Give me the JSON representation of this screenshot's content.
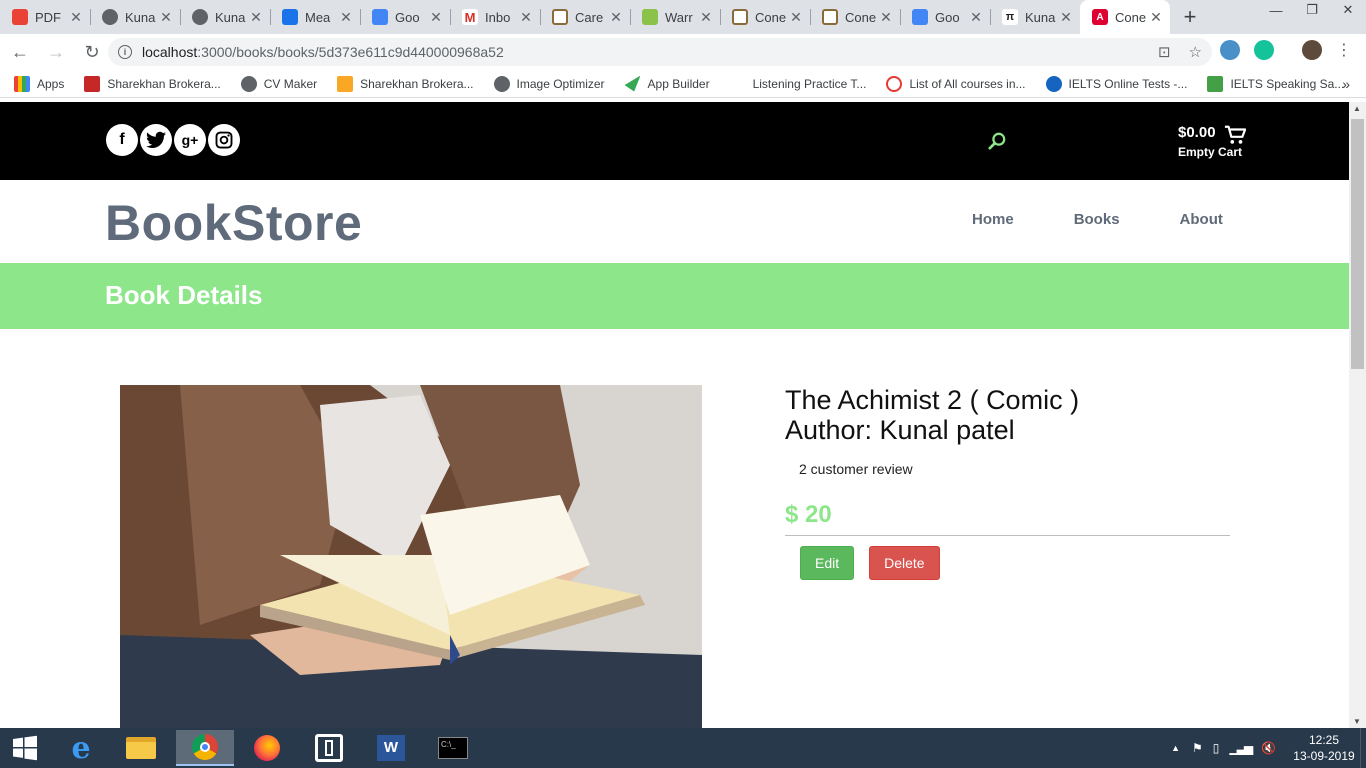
{
  "browser": {
    "tabs": [
      {
        "label": "PDF",
        "color": "#ea4335"
      },
      {
        "label": "Kuna",
        "color": "#5f6368"
      },
      {
        "label": "Kuna",
        "color": "#5f6368"
      },
      {
        "label": "Mea",
        "color": "#1a73e8"
      },
      {
        "label": "Goo",
        "color": "#4285f4"
      },
      {
        "label": "Inbo",
        "color": "#d93025"
      },
      {
        "label": "Care",
        "color": "#8a6a3a"
      },
      {
        "label": "Warr",
        "color": "#8bc34a"
      },
      {
        "label": "Cone",
        "color": "#8a6a3a"
      },
      {
        "label": "Cone",
        "color": "#8a6a3a"
      },
      {
        "label": "Goo",
        "color": "#4285f4"
      },
      {
        "label": "Kuna",
        "color": "#202124"
      },
      {
        "label": "Cone",
        "color": "#dd0031",
        "active": true
      }
    ],
    "url_host": "localhost",
    "url_path": ":3000/books/books/5d373e611c9d440000968a52",
    "bookmarks": [
      {
        "label": "Apps",
        "color": "#ea4335"
      },
      {
        "label": "Sharekhan Brokera...",
        "color": "#c62828"
      },
      {
        "label": "CV Maker",
        "color": "#5f6368"
      },
      {
        "label": "Sharekhan Brokera...",
        "color": "#f9a825"
      },
      {
        "label": "Image Optimizer",
        "color": "#5f6368"
      },
      {
        "label": "App Builder",
        "color": "#34a853"
      },
      {
        "label": "Listening Practice T...",
        "color": "#ffffff"
      },
      {
        "label": "List of All courses in...",
        "color": "#e53935"
      },
      {
        "label": "IELTS Online Tests -...",
        "color": "#1565c0"
      },
      {
        "label": "IELTS Speaking Sa...",
        "color": "#43a047"
      }
    ]
  },
  "site": {
    "cart_amount": "$0.00",
    "cart_label": "Empty Cart",
    "brand": "BookStore",
    "nav": [
      "Home",
      "Books",
      "About"
    ],
    "banner_title": "Book Details",
    "accent_color": "#8de68a"
  },
  "book": {
    "title": "The Achimist 2 ( Comic )",
    "author": "Author: Kunal patel",
    "review": "2 customer review",
    "price": "$ 20",
    "edit_label": "Edit",
    "delete_label": "Delete"
  },
  "taskbar": {
    "time": "12:25",
    "date": "13-09-2019"
  }
}
